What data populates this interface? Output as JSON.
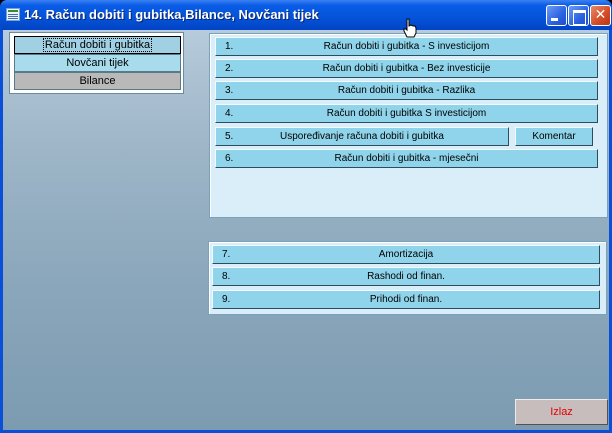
{
  "window": {
    "title": "14. Račun dobiti i gubitka,Bilance, Novčani tijek",
    "close_glyph": "✕"
  },
  "nav": {
    "items": [
      {
        "label": "Račun dobiti i gubitka"
      },
      {
        "label": "Novčani tijek"
      },
      {
        "label": "Bilance"
      }
    ]
  },
  "reports": {
    "items": [
      {
        "num": "1.",
        "label": "Račun dobiti i gubitka - S investicijom"
      },
      {
        "num": "2.",
        "label": "Račun dobiti i gubitka - Bez investicije"
      },
      {
        "num": "3.",
        "label": "Račun dobiti i gubitka - Razlika"
      },
      {
        "num": "4.",
        "label": "Račun dobiti i gubitka S investicijom"
      },
      {
        "num": "5.",
        "label": "Uspoređivanje računa dobiti i gubitka"
      },
      {
        "num": "6.",
        "label": "Račun dobiti i gubitka - mjesečni"
      }
    ],
    "comment_label": "Komentar"
  },
  "other": {
    "items": [
      {
        "num": "7.",
        "label": "Amortizacija"
      },
      {
        "num": "8.",
        "label": "Rashodi od finan."
      },
      {
        "num": "9.",
        "label": "Prihodi od finan."
      }
    ]
  },
  "exit_label": "Izlaz",
  "colors": {
    "title_bar": "#0453d8",
    "button_blue": "#8fd4ea",
    "exit_text": "#e00000"
  },
  "icons": {
    "app": "app-icon",
    "minimize": "minimize-icon",
    "maximize": "maximize-icon",
    "close": "close-icon",
    "cursor": "hand-cursor-icon"
  }
}
